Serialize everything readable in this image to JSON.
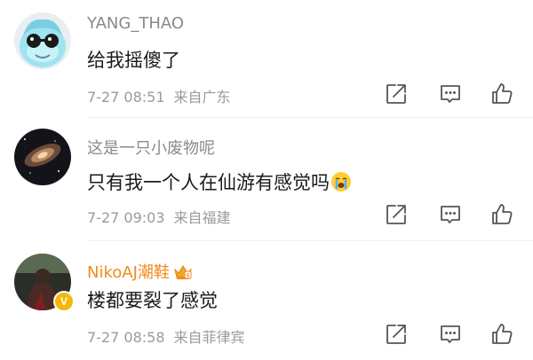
{
  "colors": {
    "username": "#8a8a8a",
    "vip_username": "#f08a1c",
    "content": "#1a1a1a",
    "meta": "#9a9a9a",
    "verified_badge": "#f5b80a"
  },
  "comments": [
    {
      "username": "YANG_THAO",
      "text": "给我摇傻了",
      "time": "7-27 08:51",
      "location": "来自广东",
      "icons": [
        "share-icon",
        "comment-icon",
        "like-icon"
      ]
    },
    {
      "username": "这是一只小废物呢",
      "text": "只有我一个人在仙游有感觉吗",
      "emoji": "crying-emoji",
      "time": "7-27 09:03",
      "location": "来自福建",
      "icons": [
        "share-icon",
        "comment-icon",
        "like-icon"
      ]
    },
    {
      "username": "NikoAJ潮鞋",
      "badge": "vip-crown-badge",
      "verified": "V",
      "text": "楼都要裂了感觉",
      "time": "7-27 08:58",
      "location": "来自菲律宾",
      "icons": [
        "share-icon",
        "comment-icon",
        "like-icon"
      ]
    }
  ]
}
